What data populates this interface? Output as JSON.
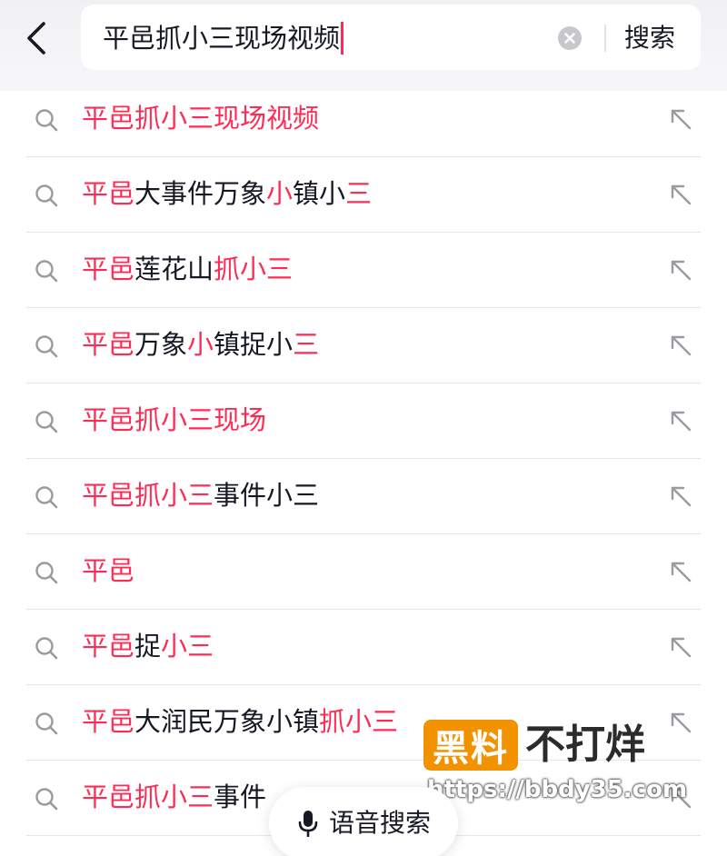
{
  "search": {
    "query": "平邑抓小三现场视频",
    "search_label": "搜索"
  },
  "suggestions": [
    {
      "segments": [
        {
          "text": "平邑抓小三现场视频",
          "highlight": true
        }
      ]
    },
    {
      "segments": [
        {
          "text": "平邑",
          "highlight": true
        },
        {
          "text": "大事件万象",
          "highlight": false
        },
        {
          "text": "小",
          "highlight": true
        },
        {
          "text": "镇小",
          "highlight": false
        },
        {
          "text": "三",
          "highlight": true
        }
      ]
    },
    {
      "segments": [
        {
          "text": "平邑",
          "highlight": true
        },
        {
          "text": "莲花山",
          "highlight": false
        },
        {
          "text": "抓小三",
          "highlight": true
        }
      ]
    },
    {
      "segments": [
        {
          "text": "平邑",
          "highlight": true
        },
        {
          "text": "万象",
          "highlight": false
        },
        {
          "text": "小",
          "highlight": true
        },
        {
          "text": "镇捉小",
          "highlight": false
        },
        {
          "text": "三",
          "highlight": true
        }
      ]
    },
    {
      "segments": [
        {
          "text": "平邑抓小三现场",
          "highlight": true
        }
      ]
    },
    {
      "segments": [
        {
          "text": "平邑抓小三",
          "highlight": true
        },
        {
          "text": "事件小三",
          "highlight": false
        }
      ]
    },
    {
      "segments": [
        {
          "text": "平邑",
          "highlight": true
        }
      ]
    },
    {
      "segments": [
        {
          "text": "平邑",
          "highlight": true
        },
        {
          "text": "捉",
          "highlight": false
        },
        {
          "text": "小三",
          "highlight": true
        }
      ]
    },
    {
      "segments": [
        {
          "text": "平邑",
          "highlight": true
        },
        {
          "text": "大润民万象小镇",
          "highlight": false
        },
        {
          "text": "抓小三",
          "highlight": true
        }
      ]
    },
    {
      "segments": [
        {
          "text": "平邑抓小三",
          "highlight": true
        },
        {
          "text": "事件",
          "highlight": false
        }
      ]
    }
  ],
  "voice_search": {
    "label": "语音搜索"
  },
  "watermark": {
    "badge": "黑料",
    "text": "不打烊",
    "url": "https://bbdy35.com"
  },
  "colors": {
    "highlight": "#fe2c55",
    "text": "#161823",
    "watermark_badge": "#f39200"
  },
  "icons": {
    "back": "chevron-left-icon",
    "clear": "clear-circle-icon",
    "suggestion": "search-icon",
    "fill": "arrow-up-left-icon",
    "voice": "microphone-icon"
  }
}
